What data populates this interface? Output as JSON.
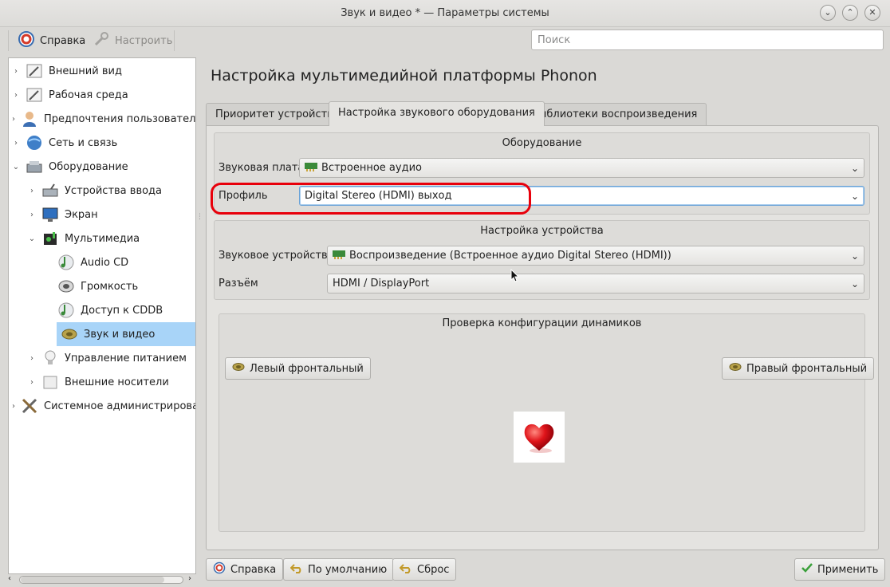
{
  "window": {
    "title": "Звук и видео * — Параметры системы"
  },
  "toolbar": {
    "help_label": "Справка",
    "configure_label": "Настроить"
  },
  "search": {
    "placeholder": "Поиск",
    "value": ""
  },
  "sidebar": {
    "items": [
      {
        "label": "Внешний вид",
        "icon": "appearance-icon",
        "arrow": "›"
      },
      {
        "label": "Рабочая среда",
        "icon": "workspace-icon",
        "arrow": "›"
      },
      {
        "label": "Предпочтения пользователя",
        "icon": "user-icon",
        "arrow": "›"
      },
      {
        "label": "Сеть и связь",
        "icon": "network-icon",
        "arrow": "›"
      },
      {
        "label": "Оборудование",
        "icon": "hardware-icon",
        "arrow": "⌄"
      },
      {
        "label": "Устройства ввода",
        "icon": "input-devices-icon",
        "arrow": "›"
      },
      {
        "label": "Экран",
        "icon": "display-icon",
        "arrow": "›"
      },
      {
        "label": "Мультимедиа",
        "icon": "multimedia-icon",
        "arrow": "⌄"
      },
      {
        "label": "Audio CD",
        "icon": "audio-cd-icon",
        "arrow": ""
      },
      {
        "label": "Громкость",
        "icon": "volume-icon",
        "arrow": ""
      },
      {
        "label": "Доступ к CDDB",
        "icon": "cddb-icon",
        "arrow": ""
      },
      {
        "label": "Звук и видео",
        "icon": "sound-video-icon",
        "arrow": "",
        "selected": true
      },
      {
        "label": "Управление питанием",
        "icon": "power-icon",
        "arrow": "›"
      },
      {
        "label": "Внешние носители",
        "icon": "removable-media-icon",
        "arrow": "›"
      },
      {
        "label": "Системное администрирован",
        "icon": "system-admin-icon",
        "arrow": "›"
      }
    ]
  },
  "main": {
    "title": "Настройка мультимедийной платформы Phonon",
    "tabs": [
      {
        "label": "Приоритет устройств"
      },
      {
        "label": "Настройка звукового оборудования",
        "active": true
      },
      {
        "label": "Библиотеки воспроизведения"
      }
    ],
    "hardware": {
      "title": "Оборудование",
      "sound_card_label": "Звуковая плата",
      "sound_card_value": "Встроенное аудио",
      "profile_label": "Профиль",
      "profile_value": "Digital Stereo (HDMI) выход"
    },
    "device": {
      "title": "Настройка устройства",
      "sound_device_label": "Звуковое устройство",
      "sound_device_value": "Воспроизведение (Встроенное аудио Digital Stereo (HDMI))",
      "connector_label": "Разъём",
      "connector_value": "HDMI / DisplayPort"
    },
    "speaker_test": {
      "title": "Проверка конфигурации динамиков",
      "left_front": "Левый фронтальный",
      "right_front": "Правый фронтальный"
    }
  },
  "footer": {
    "help": "Справка",
    "defaults": "По умолчанию",
    "reset": "Сброс",
    "apply": "Применить"
  },
  "colors": {
    "highlight": "#e8000b",
    "selection": "#a8d4f8"
  }
}
